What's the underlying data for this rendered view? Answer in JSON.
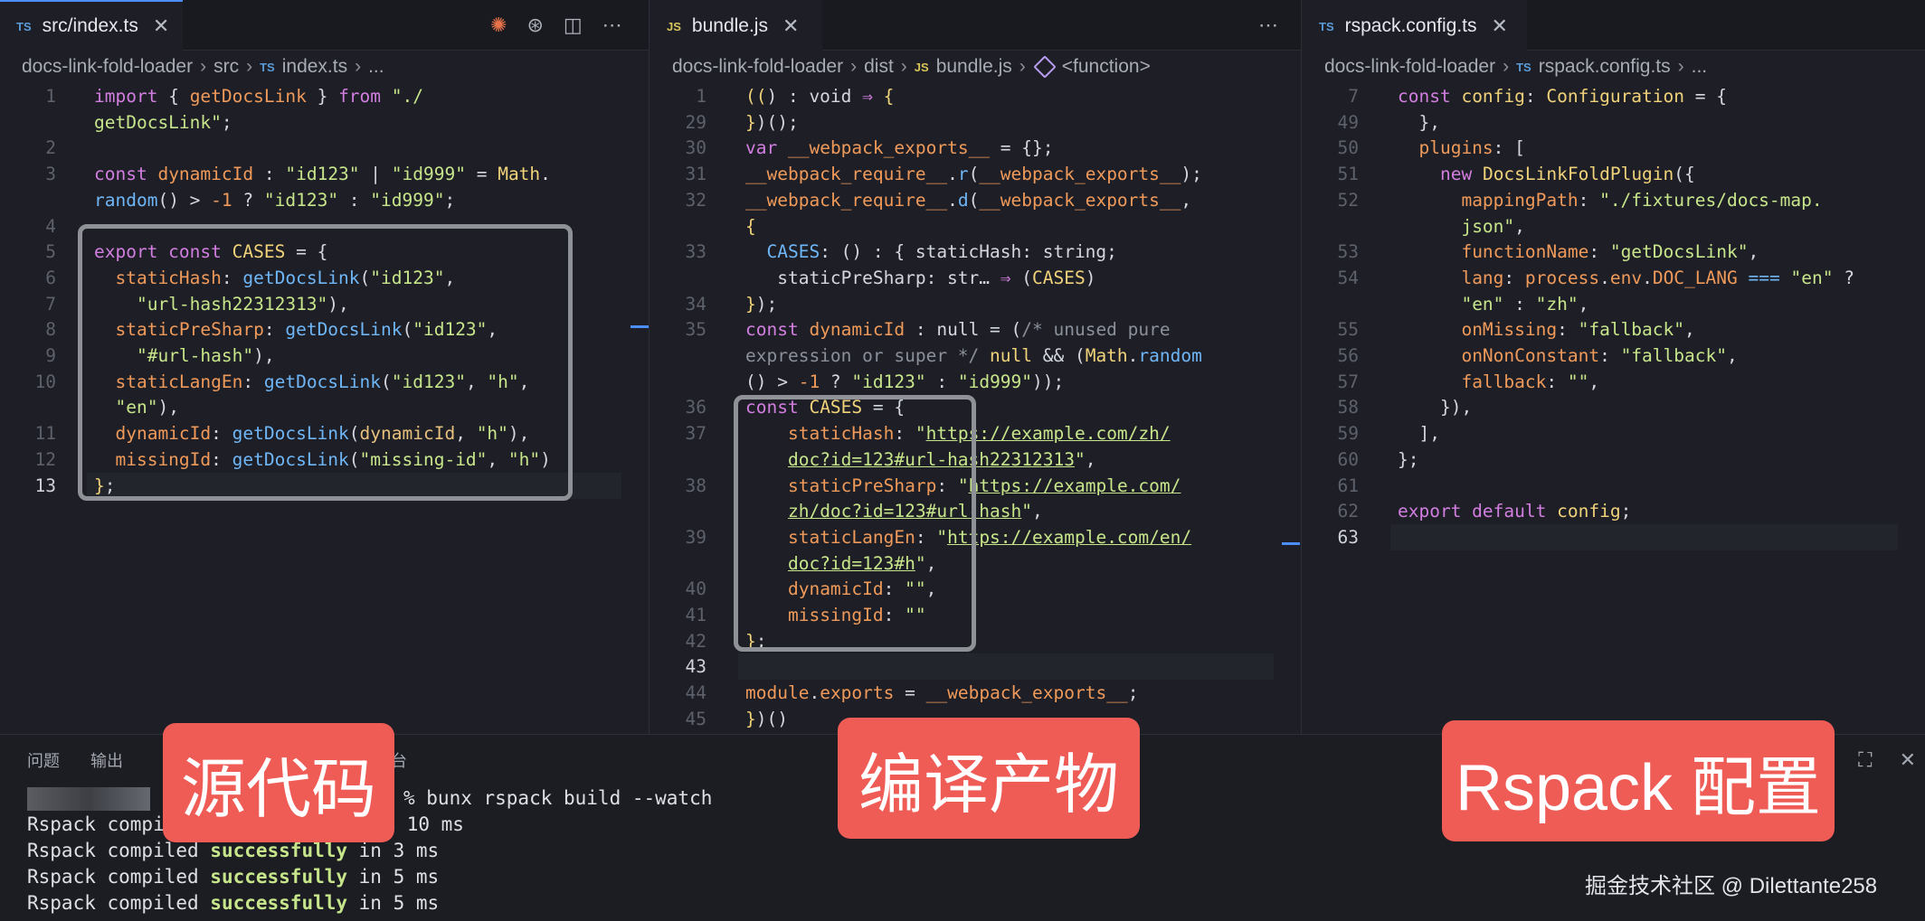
{
  "pane1": {
    "tab": {
      "lang": "TS",
      "title": "src/index.ts",
      "close": "✕"
    },
    "actions": [
      "✺",
      "⊛",
      "◫",
      "⋯"
    ],
    "breadcrumb": [
      "docs-link-fold-loader",
      "src",
      "index.ts",
      "..."
    ],
    "breadcrumb_file_lang": "TS",
    "lines": [
      {
        "n": "1",
        "html": "<span class=\"k\">import</span> { <span class=\"o\">getDocsLink</span> } <span class=\"k\">from</span> <span class=\"s\">\"./</span>"
      },
      {
        "n": "",
        "html": "<span class=\"s\">getDocsLink\"</span>;"
      },
      {
        "n": "2",
        "html": ""
      },
      {
        "n": "3",
        "html": "<span class=\"k\">const</span> <span class=\"o\">dynamicId</span> : <span class=\"s\">\"id123\"</span> | <span class=\"s\">\"id999\"</span> = <span class=\"y\">Math</span>."
      },
      {
        "n": "",
        "html": "<span class=\"f\">random</span>() &gt; <span class=\"o\">-1</span> ? <span class=\"s\">\"id123\"</span> : <span class=\"s\">\"id999\"</span>;"
      },
      {
        "n": "4",
        "html": ""
      },
      {
        "n": "5",
        "html": "<span class=\"k\">export const</span> <span class=\"y\">CASES</span> = {"
      },
      {
        "n": "6",
        "html": "  <span class=\"o\">staticHash</span>: <span class=\"f\">getDocsLink</span>(<span class=\"s\">\"id123\"</span>,"
      },
      {
        "n": "7",
        "html": "    <span class=\"s\">\"url-hash22312313\"</span>),"
      },
      {
        "n": "8",
        "html": "  <span class=\"o\">staticPreSharp</span>: <span class=\"f\">getDocsLink</span>(<span class=\"s\">\"id123\"</span>,"
      },
      {
        "n": "9",
        "html": "    <span class=\"s\">\"#url-hash\"</span>),"
      },
      {
        "n": "10",
        "html": "  <span class=\"o\">staticLangEn</span>: <span class=\"f\">getDocsLink</span>(<span class=\"s\">\"id123\"</span>, <span class=\"s\">\"h\"</span>,"
      },
      {
        "n": "",
        "html": "  <span class=\"s\">\"en\"</span>),"
      },
      {
        "n": "11",
        "html": "  <span class=\"o\">dynamicId</span>: <span class=\"f\">getDocsLink</span>(<span class=\"n\">dynamicId</span>, <span class=\"s\">\"h\"</span>),"
      },
      {
        "n": "12",
        "html": "  <span class=\"o\">missingId</span>: <span class=\"f\">getDocsLink</span>(<span class=\"s\">\"missing-id\"</span>, <span class=\"s\">\"h\"</span>)"
      },
      {
        "n": "13",
        "html": "<span class=\"y\">}</span>;",
        "current": true
      }
    ]
  },
  "pane2": {
    "tab": {
      "lang": "JS",
      "title": "bundle.js",
      "close": "✕"
    },
    "actions": [
      "⋯"
    ],
    "breadcrumb": [
      "docs-link-fold-loader",
      "dist",
      "bundle.js",
      "<function>"
    ],
    "breadcrumb_file_lang": "JS",
    "lines": [
      {
        "n": "1",
        "html": "<span class=\"y\">((</span>) : void <span class=\"k\">⇒</span> <span class=\"y\">{</span>"
      },
      {
        "n": "29",
        "html": "<span class=\"y\">}</span>)();"
      },
      {
        "n": "30",
        "html": "<span class=\"k\">var</span> <span class=\"o\">__webpack_exports__</span> = {};"
      },
      {
        "n": "31",
        "html": "<span class=\"o\">__webpack_require__</span>.<span class=\"f\">r</span>(<span class=\"o\">__webpack_exports__</span>);"
      },
      {
        "n": "32",
        "html": "<span class=\"o\">__webpack_require__</span>.<span class=\"f\">d</span>(<span class=\"o\">__webpack_exports__</span>,"
      },
      {
        "n": "",
        "html": "<span class=\"y\">{</span>"
      },
      {
        "n": "33",
        "html": "  <span class=\"f\">CASES</span>: () : { staticHash: string;"
      },
      {
        "n": "",
        "html": "   staticPreSharp: str… <span class=\"k\">⇒</span> (<span class=\"y\">CASES</span>)"
      },
      {
        "n": "34",
        "html": "<span class=\"y\">}</span>);"
      },
      {
        "n": "35",
        "html": "<span class=\"k\">const</span> <span class=\"o\">dynamicId</span> : null = (<span class=\"c\">/* unused pure</span>"
      },
      {
        "n": "",
        "html": "<span class=\"c\">expression or super */</span> <span class=\"y\">null</span> &amp;&amp; (<span class=\"y\">Math</span>.<span class=\"f\">random</span>"
      },
      {
        "n": "",
        "html": "() &gt; <span class=\"o\">-1</span> ? <span class=\"s\">\"id123\"</span> : <span class=\"s\">\"id999\"</span>));"
      },
      {
        "n": "36",
        "html": "<span class=\"k\">const</span> <span class=\"y\">CASES</span> = {"
      },
      {
        "n": "37",
        "html": "    <span class=\"o\">staticHash</span>: <span class=\"s\">\"</span><span class=\"u\">https://example.com/zh/</span>"
      },
      {
        "n": "",
        "html": "    <span class=\"u\">doc?id=123#url-hash22312313</span><span class=\"s\">\"</span>,"
      },
      {
        "n": "38",
        "html": "    <span class=\"o\">staticPreSharp</span>: <span class=\"s\">\"</span><span class=\"u\">https://example.com/</span>"
      },
      {
        "n": "",
        "html": "    <span class=\"u\">zh/doc?id=123#url-hash</span><span class=\"s\">\"</span>,"
      },
      {
        "n": "39",
        "html": "    <span class=\"o\">staticLangEn</span>: <span class=\"s\">\"</span><span class=\"u\">https://example.com/en/</span>"
      },
      {
        "n": "",
        "html": "    <span class=\"u\">doc?id=123#h</span><span class=\"s\">\"</span>,"
      },
      {
        "n": "40",
        "html": "    <span class=\"o\">dynamicId</span>: <span class=\"s\">\"\"</span>,"
      },
      {
        "n": "41",
        "html": "    <span class=\"o\">missingId</span>: <span class=\"s\">\"\"</span>"
      },
      {
        "n": "42",
        "html": "<span class=\"y\">}</span>;"
      },
      {
        "n": "43",
        "html": "",
        "current": true
      },
      {
        "n": "44",
        "html": "<span class=\"o\">module</span>.<span class=\"o\">exports</span> = <span class=\"o\">__webpack_exports__</span>;"
      },
      {
        "n": "45",
        "html": "<span class=\"y\">}</span>)()"
      }
    ]
  },
  "pane3": {
    "tab": {
      "lang": "TS",
      "title": "rspack.config.ts",
      "close": "✕"
    },
    "breadcrumb": [
      "docs-link-fold-loader",
      "rspack.config.ts",
      "..."
    ],
    "breadcrumb_file_lang": "TS",
    "lines": [
      {
        "n": "7",
        "html": "<span class=\"k\">const</span> <span class=\"y\">config</span>: <span class=\"y\">Configuration</span> = {"
      },
      {
        "n": "49",
        "html": "  },"
      },
      {
        "n": "50",
        "html": "  <span class=\"o\">plugins</span>: ["
      },
      {
        "n": "51",
        "html": "    <span class=\"k\">new</span> <span class=\"y\">DocsLinkFoldPlugin</span>({"
      },
      {
        "n": "52",
        "html": "      <span class=\"o\">mappingPath</span>: <span class=\"s\">\"./fixtures/docs-map.</span>"
      },
      {
        "n": "",
        "html": "      <span class=\"s\">json\"</span>,"
      },
      {
        "n": "53",
        "html": "      <span class=\"o\">functionName</span>: <span class=\"s\">\"getDocsLink\"</span>,"
      },
      {
        "n": "54",
        "html": "      <span class=\"o\">lang</span>: <span class=\"o\">process</span>.<span class=\"o\">env</span>.<span class=\"o\">DOC_LANG</span> <span class=\"f\">===</span> <span class=\"s\">\"en\"</span> ?"
      },
      {
        "n": "",
        "html": "      <span class=\"s\">\"en\"</span> : <span class=\"s\">\"zh\"</span>,"
      },
      {
        "n": "55",
        "html": "      <span class=\"o\">onMissing</span>: <span class=\"s\">\"fallback\"</span>,"
      },
      {
        "n": "56",
        "html": "      <span class=\"o\">onNonConstant</span>: <span class=\"s\">\"fallback\"</span>,"
      },
      {
        "n": "57",
        "html": "      <span class=\"o\">fallback</span>: <span class=\"s\">\"\"</span>,"
      },
      {
        "n": "58",
        "html": "    }),"
      },
      {
        "n": "59",
        "html": "  ],"
      },
      {
        "n": "60",
        "html": "};"
      },
      {
        "n": "61",
        "html": ""
      },
      {
        "n": "62",
        "html": "<span class=\"k\">export default</span> <span class=\"y\">config</span>;"
      },
      {
        "n": "63",
        "html": "",
        "current": true
      }
    ]
  },
  "panel": {
    "tabs": [
      "问题",
      "输出",
      "调试控制台"
    ],
    "icons": [
      "│",
      "⛶",
      "✕"
    ],
    "terminal": {
      "prompt_suffix": "% bunx rspack build --watch",
      "first_line_fragment": "Rspack compi",
      "first_line_tail": "10 ms",
      "lines": [
        {
          "pre": "Rspack compiled ",
          "ok": "successfully",
          "post": " in 3 ms"
        },
        {
          "pre": "Rspack compiled ",
          "ok": "successfully",
          "post": " in 5 ms"
        },
        {
          "pre": "Rspack compiled ",
          "ok": "successfully",
          "post": " in 5 ms"
        }
      ]
    }
  },
  "badges": {
    "source": "源代码",
    "output": "编译产物",
    "config": "Rspack 配置",
    "color": "#ef5b55"
  },
  "watermark": "掘金技术社区 @ Dilettante258"
}
